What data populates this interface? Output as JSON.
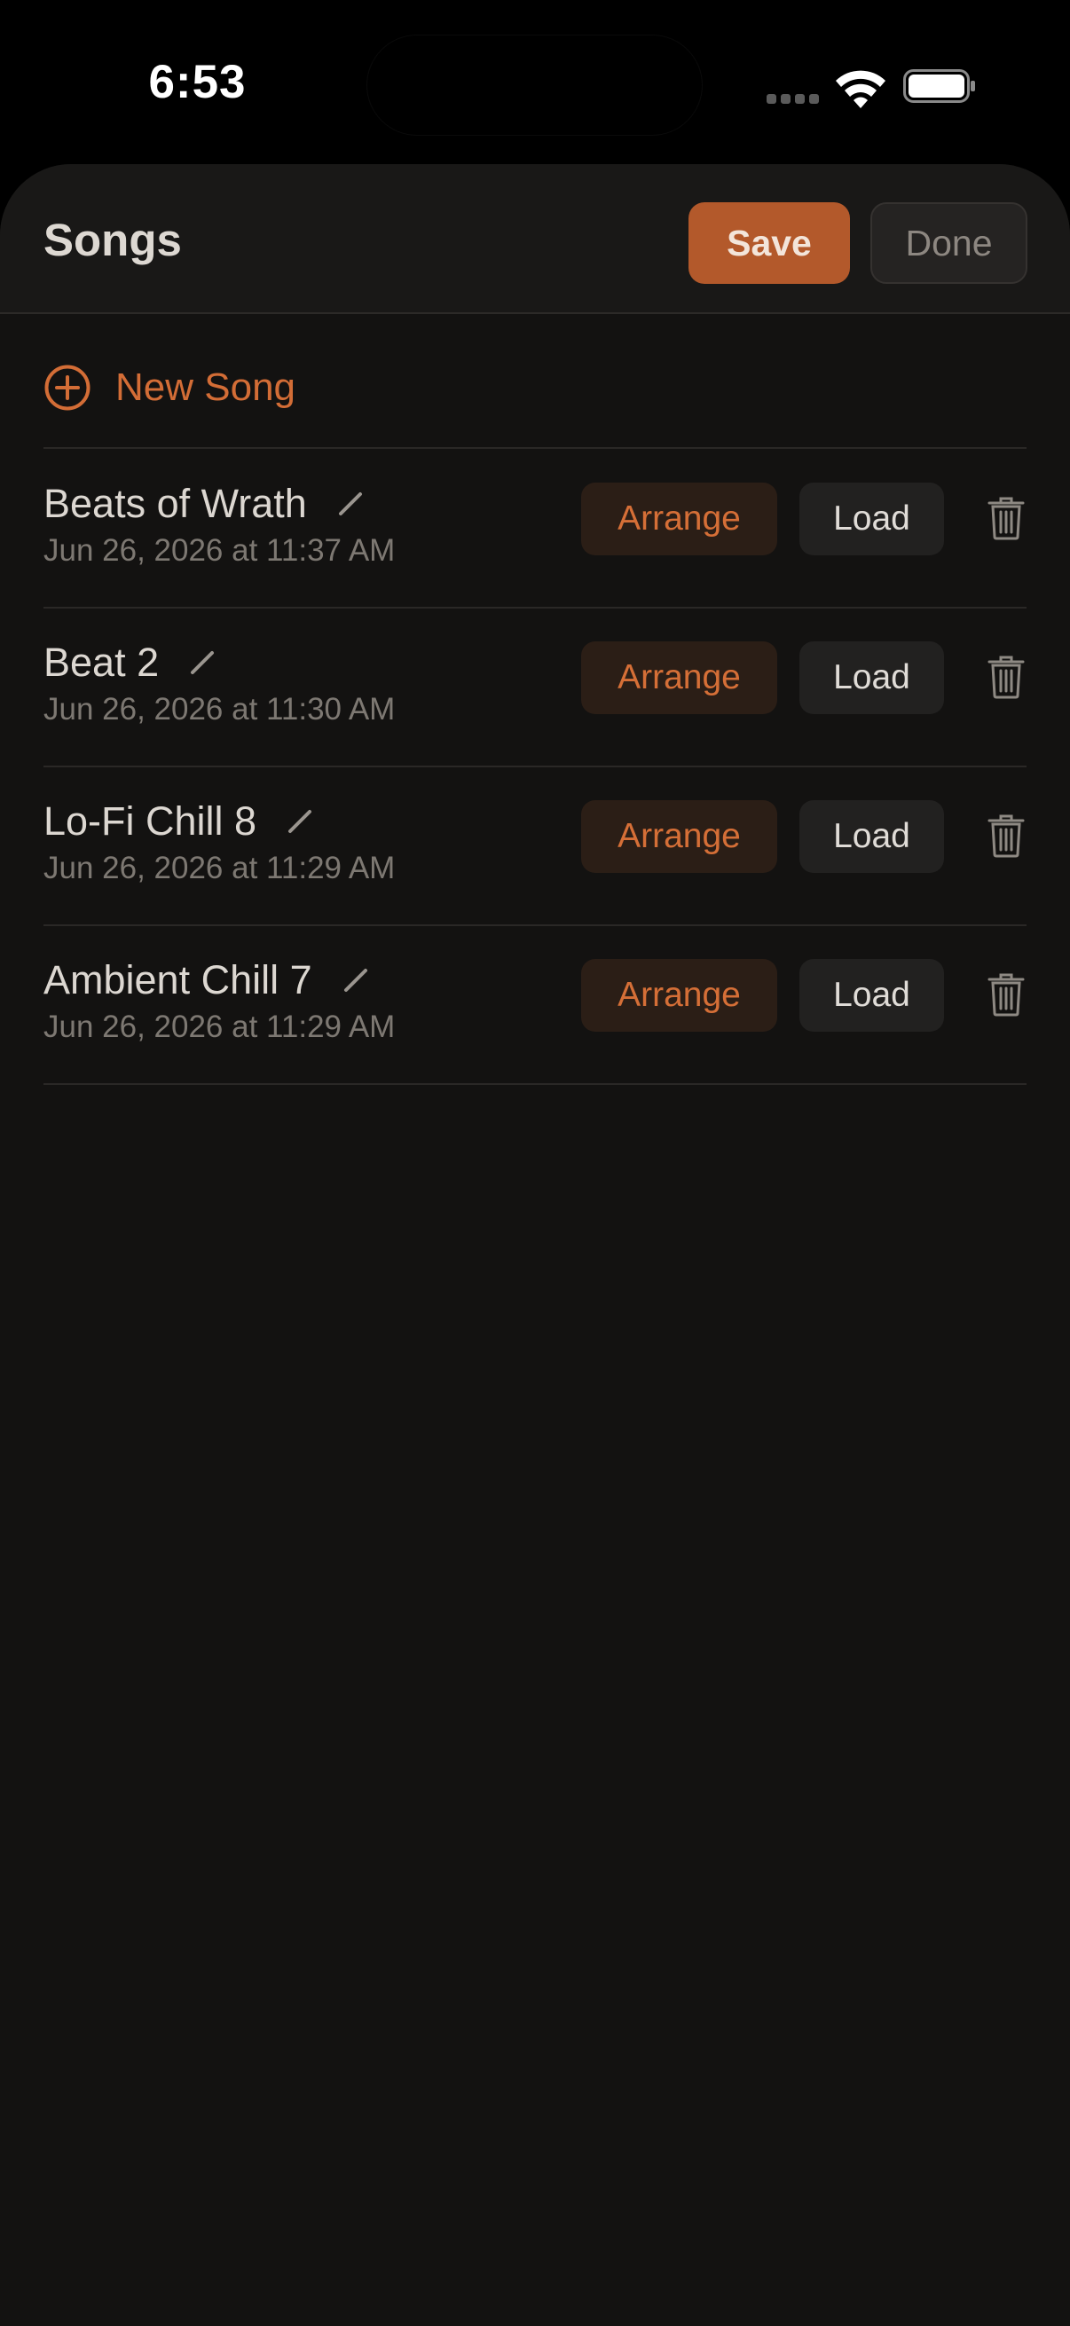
{
  "status_bar": {
    "time": "6:53"
  },
  "header": {
    "title": "Songs",
    "save_label": "Save",
    "done_label": "Done"
  },
  "new_song": {
    "label": "New Song",
    "icon": "plus-circle-icon"
  },
  "songs": [
    {
      "name": "Beats of Wrath",
      "date": "Jun 26, 2026 at 11:37 AM",
      "arrange_label": "Arrange",
      "load_label": "Load"
    },
    {
      "name": "Beat 2",
      "date": "Jun 26, 2026 at 11:30 AM",
      "arrange_label": "Arrange",
      "load_label": "Load"
    },
    {
      "name": "Lo-Fi Chill 8",
      "date": "Jun 26, 2026 at 11:29 AM",
      "arrange_label": "Arrange",
      "load_label": "Load"
    },
    {
      "name": "Ambient Chill 7",
      "date": "Jun 26, 2026 at 11:29 AM",
      "arrange_label": "Arrange",
      "load_label": "Load"
    }
  ],
  "colors": {
    "accent": "#d36d36",
    "save_bg": "#b3592b",
    "background": "#131211",
    "header_bg": "#191817"
  },
  "icons": {
    "edit": "pencil-icon",
    "delete": "trash-icon"
  }
}
